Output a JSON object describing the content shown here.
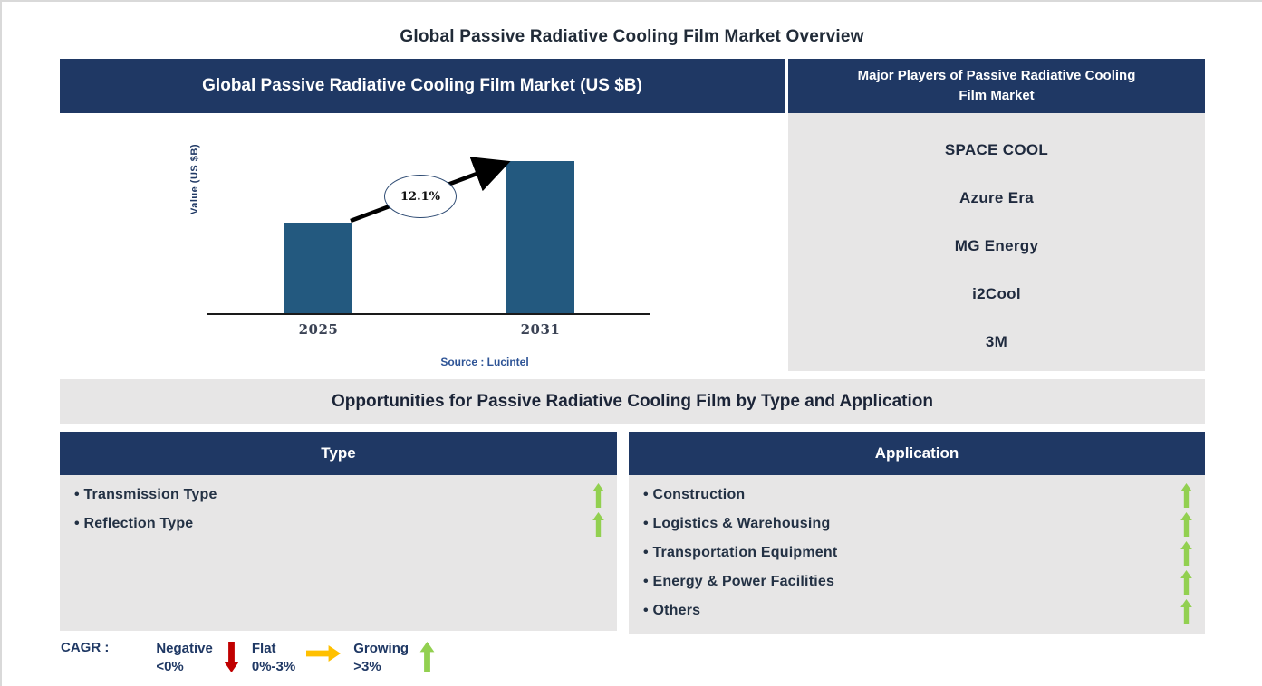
{
  "page": {
    "title": "Global Passive Radiative Cooling Film Market Overview"
  },
  "chart_panel": {
    "header": "Global Passive Radiative Cooling Film Market (US $B)"
  },
  "chart_data": {
    "type": "bar",
    "title": "Global Passive Radiative Cooling Film Market (US $B)",
    "categories": [
      "2025",
      "2031"
    ],
    "values": [
      1.0,
      1.67
    ],
    "values_note": "y-axis unlabeled; values are relative bar heights, 2031 ≈ 1.67× 2025",
    "xlabel": "",
    "ylabel": "Value (US $B)",
    "annotation": "12.1%",
    "annotation_meaning": "CAGR 2025-2031",
    "source": "Source : Lucintel",
    "bar_color": "#23597f",
    "grid": false,
    "legend_position": "none"
  },
  "players_panel": {
    "header": "Major Players of Passive Radiative Cooling Film Market",
    "players": [
      "SPACE COOL",
      "Azure Era",
      "MG Energy",
      "i2Cool",
      "3M"
    ]
  },
  "opportunities": {
    "title": "Opportunities for Passive Radiative Cooling Film by Type and Application",
    "type_panel": {
      "header": "Type",
      "items": [
        {
          "label": "Transmission Type",
          "trend": "growing"
        },
        {
          "label": "Reflection Type",
          "trend": "growing"
        }
      ]
    },
    "application_panel": {
      "header": "Application",
      "items": [
        {
          "label": "Construction",
          "trend": "growing"
        },
        {
          "label": "Logistics & Warehousing",
          "trend": "growing"
        },
        {
          "label": "Transportation Equipment",
          "trend": "growing"
        },
        {
          "label": "Energy & Power Facilities",
          "trend": "growing"
        },
        {
          "label": "Others",
          "trend": "growing"
        }
      ]
    }
  },
  "legend": {
    "label": "CAGR :",
    "items": [
      {
        "name": "Negative",
        "range": "<0%",
        "arrow": "down",
        "color": "#c00000"
      },
      {
        "name": "Flat",
        "range": "0%-3%",
        "arrow": "right",
        "color": "#ffc000"
      },
      {
        "name": "Growing",
        "range": ">3%",
        "arrow": "up",
        "color": "#92d050"
      }
    ]
  },
  "colors": {
    "header_navy": "#1f3864",
    "panel_gray": "#e7e6e6",
    "bar_blue": "#23597f",
    "growing_green": "#92d050",
    "negative_red": "#c00000",
    "flat_yellow": "#ffc000",
    "source_blue": "#2e5496",
    "dark_text": "#212b38"
  }
}
